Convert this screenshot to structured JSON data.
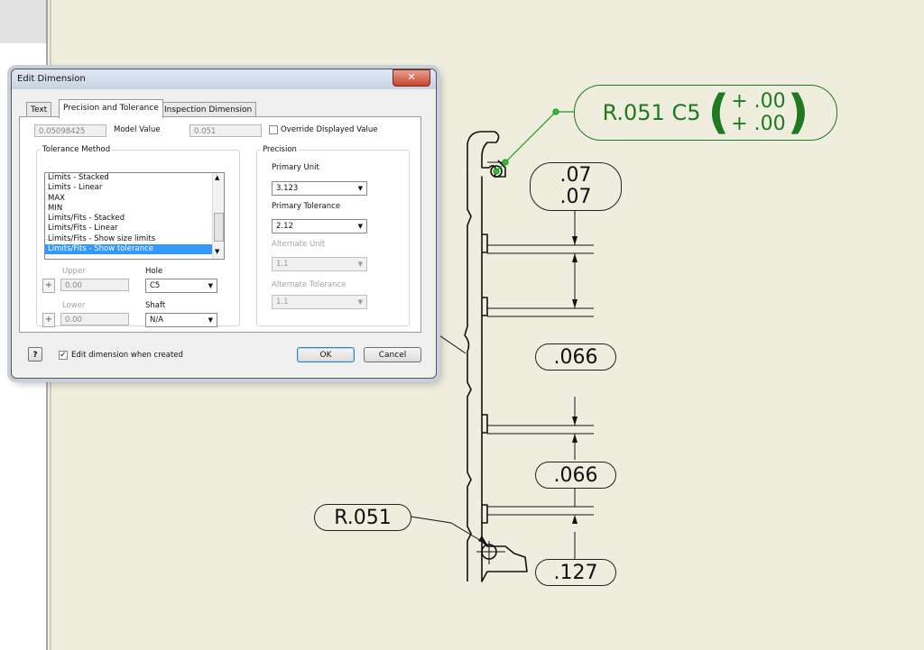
{
  "drawing": {
    "note_callout": {
      "text": "R.051 C5",
      "upper": "+ .00",
      "lower": "+ .00",
      "color": "#1e7a1e"
    },
    "dim_07": {
      "top": ".07",
      "bottom": ".07"
    },
    "dim_066_a": ".066",
    "dim_066_b": ".066",
    "dim_127": ".127",
    "radius_label": "R.051"
  },
  "dialog": {
    "title": "Edit Dimension",
    "close_glyph": "✕",
    "tabs": [
      "Text",
      "Precision and Tolerance",
      "Inspection Dimension"
    ],
    "model_value_field": "0.05098425",
    "model_value_label": "Model Value",
    "display_value_field": "0.051",
    "override_label": "Override Displayed Value",
    "tolerance_method_label": "Tolerance Method",
    "tolerance_methods": [
      "Limits - Stacked",
      "Limits - Linear",
      "MAX",
      "MIN",
      "Limits/Fits - Stacked",
      "Limits/Fits - Linear",
      "Limits/Fits - Show size limits",
      "Limits/Fits - Show tolerance"
    ],
    "upper_label": "Upper",
    "upper_value": "0.00",
    "lower_label": "Lower",
    "lower_value": "0.00",
    "hole_label": "Hole",
    "hole_value": "C5",
    "shaft_label": "Shaft",
    "shaft_value": "N/A",
    "precision_label": "Precision",
    "primary_unit_label": "Primary Unit",
    "primary_unit_value": "3.123",
    "primary_tolerance_label": "Primary Tolerance",
    "primary_tolerance_value": "2.12",
    "alternate_unit_label": "Alternate Unit",
    "alternate_unit_value": "1.1",
    "alternate_tolerance_label": "Alternate Tolerance",
    "alternate_tolerance_value": "1.1",
    "help_glyph": "?",
    "edit_when_created_label": "Edit dimension when created",
    "ok_label": "OK",
    "cancel_label": "Cancel"
  }
}
